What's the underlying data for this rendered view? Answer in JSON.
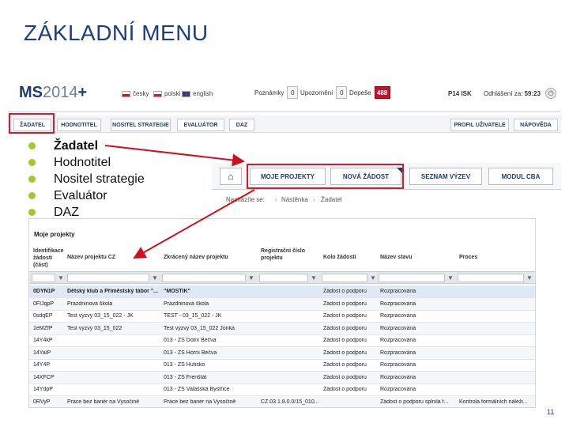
{
  "slide": {
    "title": "ZÁKLADNÍ MENU",
    "page_number": "11"
  },
  "header": {
    "logo_main": "MS",
    "logo_year": "2014",
    "logo_plus": "+",
    "languages": [
      "česky",
      "polski",
      "english"
    ],
    "notes_label": "Poznámky",
    "notes_count": "0",
    "alerts_label": "Upozornění",
    "alerts_count": "0",
    "messages_label": "Depeše",
    "messages_count": "488",
    "user": "P14 ISK",
    "logout_label": "Odhlášení za:",
    "logout_time": "59:23"
  },
  "topnav": {
    "items": [
      "ŽADATEL",
      "HODNOTITEL",
      "NOSITEL STRATEGIE",
      "EVALUÁTOR",
      "DAZ"
    ],
    "right": [
      "PROFIL UŽIVATELE",
      "NÁPOVĚDA"
    ]
  },
  "bullets": [
    "Žadatel",
    "Hodnotitel",
    "Nositel strategie",
    "Evaluátor",
    "DAZ"
  ],
  "subnav": {
    "items": [
      "MOJE PROJEKTY",
      "NOVÁ ŽÁDOST",
      "SEZNAM VÝZEV",
      "MODUL CBA"
    ]
  },
  "breadcrumb": [
    "Nacházíte se:",
    "Nástěnka",
    "Žadatel"
  ],
  "table": {
    "title": "Moje projekty",
    "headers": [
      "Identifikace žádosti (část)",
      "Název projektu CZ",
      "Zkrácený název projektu",
      "Registrační číslo projektu",
      "Kolo žádosti",
      "Název stavu",
      "Proces"
    ],
    "rows": [
      [
        "0DYN1P",
        "Dětský klub a Příměstský tábor \"...",
        "\"MOSTÍK\"",
        "",
        "Žádost o podporu",
        "Rozpracována",
        ""
      ],
      [
        "0FIJqpP",
        "Prázdninová škola",
        "Prázdninová škola",
        "",
        "Žádost o podporu",
        "Rozpracována",
        ""
      ],
      [
        "0sdqEP",
        "Test výzvy 03_15_022 - JK",
        "TEST - 03_15_022 - JK",
        "",
        "Žádost o podporu",
        "Rozpracována",
        ""
      ],
      [
        "1eMZfP",
        "Test výzvy 03_15_022",
        "Test výzvy 03_15_022 Jonka",
        "",
        "Žádost o podporu",
        "Rozpracována",
        ""
      ],
      [
        "14Y4kP",
        "",
        "013 - ZŠ Dolní Bečva",
        "",
        "Žádost o podporu",
        "Rozpracována",
        ""
      ],
      [
        "14YaIP",
        "",
        "013 - ZŠ Horní Bečva",
        "",
        "Žádost o podporu",
        "Rozpracována",
        ""
      ],
      [
        "14Y4P",
        "",
        "013 - ZŠ Hutisko",
        "",
        "Žádost o podporu",
        "Rozpracována",
        ""
      ],
      [
        "14XFCP",
        "",
        "013 - ZŠ Frenštát",
        "",
        "Žádost o podporu",
        "Rozpracována",
        ""
      ],
      [
        "14YdpP",
        "",
        "013 - ZŠ Valašská Bystřice",
        "",
        "Žádost o podporu",
        "Rozpracována",
        ""
      ],
      [
        "0RVyP",
        "Práce bez bariér na Vysočině",
        "Práce bez bariér na Vysočině",
        "CZ.03.1.8.0.0/15_010...",
        "",
        "Žádost o podporu splnila f...",
        "Kontrola formálních náleži..."
      ]
    ]
  }
}
